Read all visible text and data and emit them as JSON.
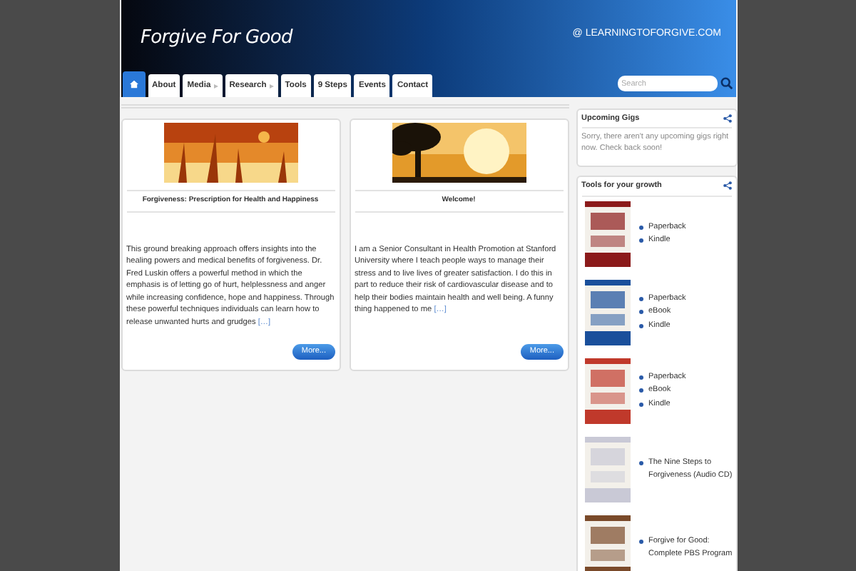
{
  "header": {
    "title": "Forgive For Good",
    "email": "@ LEARNINGTOFORGIVE.COM"
  },
  "nav": [
    {
      "kind": "home",
      "selected": true
    },
    {
      "kind": "link",
      "label": "About",
      "selected": false,
      "has_submenu": false
    },
    {
      "kind": "link",
      "label": "Media",
      "selected": false,
      "has_submenu": true
    },
    {
      "kind": "link",
      "label": "Research",
      "selected": false,
      "has_submenu": true
    },
    {
      "kind": "link",
      "label": "Tools",
      "selected": false,
      "has_submenu": false
    },
    {
      "kind": "link",
      "label": "9 Steps",
      "selected": false,
      "has_submenu": false
    },
    {
      "kind": "link",
      "label": "Events",
      "selected": false,
      "has_submenu": false
    },
    {
      "kind": "link",
      "label": "Contact",
      "selected": false,
      "has_submenu": false
    }
  ],
  "search": {
    "placeholder": "Search"
  },
  "posts": [
    {
      "title": "Forgiveness: Prescription for Health and Happiness",
      "excerpt": "This ground breaking approach offers insights into the healing powers and medical benefits of forgiveness. Dr. Fred Luskin offers a powerful method in which the emphasis is of letting go of hurt, helplessness and anger while increasing confidence, hope and happiness. Through these powerful techniques individuals can learn how to release unwanted hurts and grudges",
      "more_link": "[…]",
      "button": "More..."
    },
    {
      "title": "Welcome!",
      "excerpt": "I am a Senior Consultant in Health Promotion at Stanford University where I teach people ways to manage their stress and to live lives of greater satisfaction. I do this in part to reduce their risk of cardiovascular disease and to help their bodies maintain health and well being. A funny thing happened to me",
      "more_link": "[…]",
      "button": "More..."
    }
  ],
  "sidebar": {
    "gigs": {
      "title": "Upcoming Gigs",
      "text": "Sorry, there aren't any upcoming gigs right now. Check back soon!"
    },
    "tools": {
      "title": "Tools for your growth",
      "books": [
        {
          "links": [
            "Paperback",
            "Kindle"
          ]
        },
        {
          "links": [
            "Paperback",
            "eBook",
            "Kindle"
          ]
        },
        {
          "links": [
            "Paperback",
            "eBook",
            "Kindle"
          ]
        },
        {
          "links": [
            "The Nine Steps to Forgiveness (Audio CD)"
          ]
        },
        {
          "links": [
            "Forgive for Good: Complete PBS Program"
          ]
        }
      ]
    }
  }
}
